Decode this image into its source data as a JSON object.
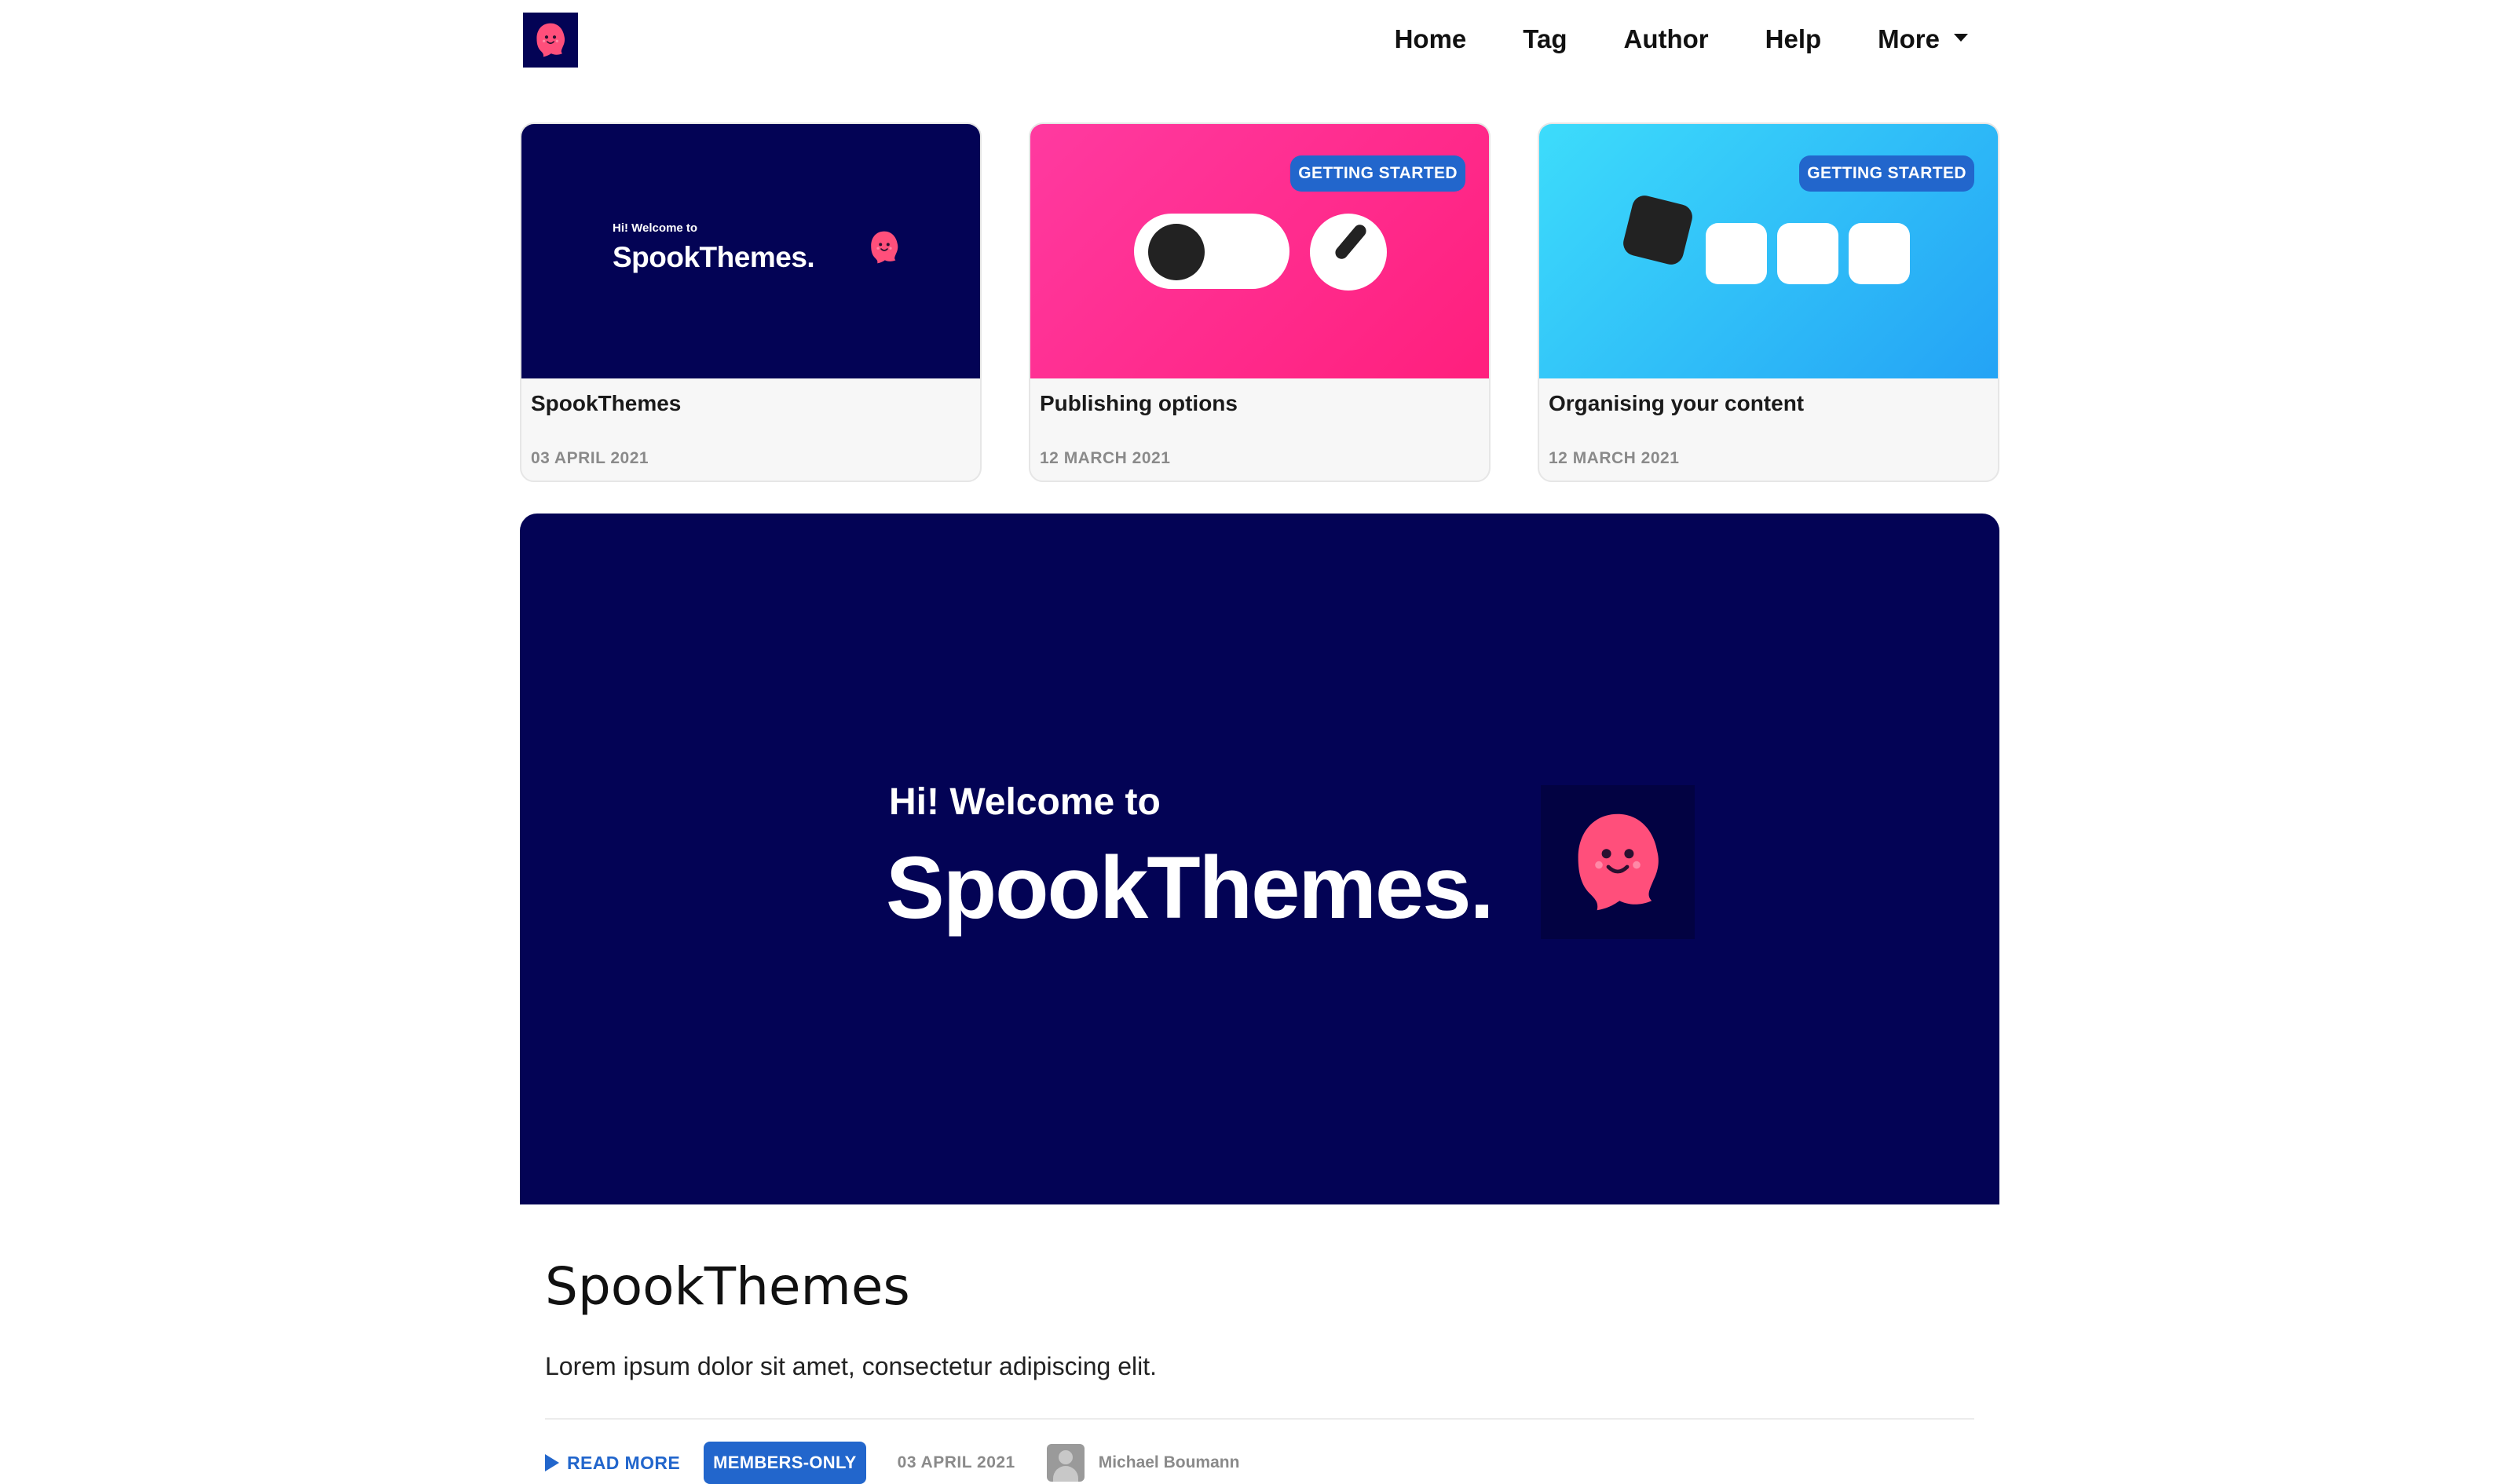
{
  "site": {
    "logo_icon": "ghost-icon",
    "brand_color": "#030355",
    "accent_color": "#2266cc",
    "ghost_color": "#ff4f7b"
  },
  "nav": {
    "items": [
      {
        "label": "Home"
      },
      {
        "label": "Tag"
      },
      {
        "label": "Author"
      },
      {
        "label": "Help"
      },
      {
        "label": "More"
      }
    ]
  },
  "cards": [
    {
      "title": "SpookThemes",
      "date": "03 APRIL 2021",
      "tag": "",
      "image": {
        "hi": "Hi! Welcome to",
        "brand": "SpookThemes."
      }
    },
    {
      "title": "Publishing options",
      "date": "12 MARCH 2021",
      "tag": "GETTING STARTED"
    },
    {
      "title": "Organising your content",
      "date": "12 MARCH 2021",
      "tag": "GETTING STARTED"
    }
  ],
  "featured": {
    "image": {
      "hi": "Hi! Welcome to",
      "brand": "SpookThemes."
    },
    "title": "SpookThemes",
    "excerpt": "Lorem ipsum dolor sit amet, consectetur adipiscing elit.",
    "read_more": "READ MORE",
    "badge": "MEMBERS-ONLY",
    "date": "03 APRIL 2021",
    "author": "Michael Boumann"
  }
}
